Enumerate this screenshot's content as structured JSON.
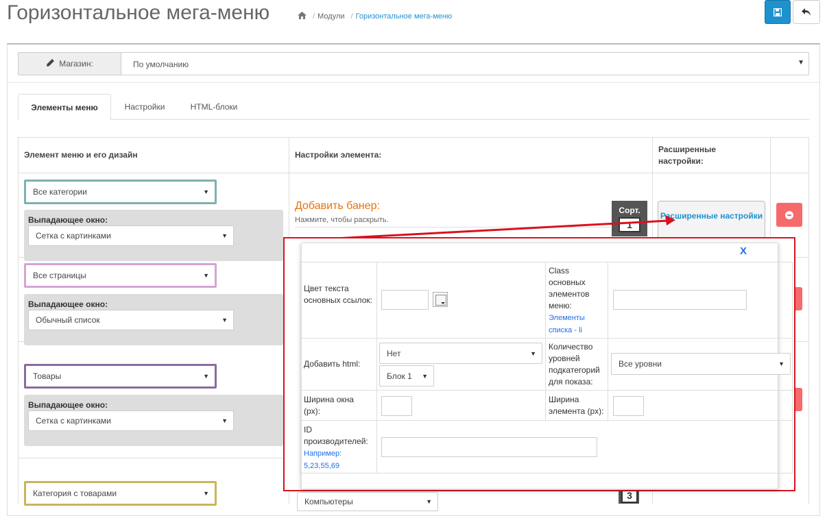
{
  "header": {
    "title": "Горизонтальное мега-меню",
    "breadcrumb": [
      "Модули",
      "Горизонтальное мега-меню"
    ]
  },
  "store": {
    "label": "Магазин:",
    "value": "По умолчанию"
  },
  "tabs": [
    {
      "label": "Элементы меню",
      "active": true
    },
    {
      "label": "Настройки",
      "active": false
    },
    {
      "label": "HTML-блоки",
      "active": false
    }
  ],
  "table": {
    "col1": "Элемент меню и его дизайн",
    "col2": "Настройки элемента:",
    "col3": "Расширенные настройки:"
  },
  "rows": [
    {
      "item": "Все категории",
      "dropdown_label": "Выпадающее окно:",
      "dropdown_value": "Сетка с картинками",
      "border_color": "#7fb0b0"
    },
    {
      "item": "Все страницы",
      "dropdown_label": "Выпадающее окно:",
      "dropdown_value": "Обычный список",
      "border_color": "#d8a3d0"
    },
    {
      "item": "Товары",
      "dropdown_label": "Выпадающее окно:",
      "dropdown_value": "Сетка с картинками",
      "border_color": "#8a6aa0"
    },
    {
      "item": "Категория с товарами",
      "border_color": "#c9b45a"
    }
  ],
  "banner": {
    "title": "Добавить банер:",
    "subtitle": "Нажмите, чтобы раскрыть."
  },
  "sort": {
    "label": "Сорт.",
    "row1_value": "1",
    "row4_value": "3"
  },
  "extended_button": "Расширенные настройки",
  "row4_select": "Компьютеры",
  "popup": {
    "close": "X",
    "link_color_label": "Цвет текста основных ссылок:",
    "class_label": "Class основных элементов меню:",
    "class_hint": "Элементы списка - li",
    "add_html_label": "Добавить html:",
    "add_html_value": "Нет",
    "block_value": "Блок 1",
    "levels_label": "Количество уровней подкатегорий для показа:",
    "levels_value": "Все уровни",
    "window_width_label": "Ширина окна (px):",
    "element_width_label": "Ширина элемента (px):",
    "manufacturers_label": "ID производителей:",
    "manufacturers_hint": "Например: 5,23,55,69"
  },
  "colors": {
    "primary": "#1e91cf",
    "danger": "#f56b6b",
    "highlight": "#d9121d",
    "banner": "#e8710a"
  }
}
